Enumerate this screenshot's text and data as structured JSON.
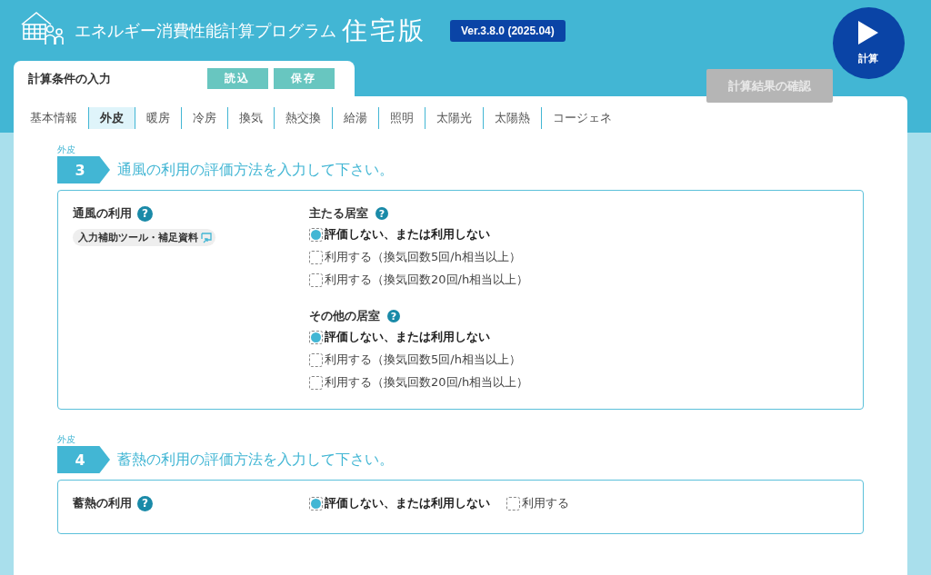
{
  "header": {
    "title": "エネルギー消費性能計算プログラム",
    "edition": "住宅版",
    "version": "Ver.3.8.0 (2025.04)",
    "run_button": "計算"
  },
  "input_panel": {
    "label": "計算条件の入力",
    "buttons": [
      "読込",
      "保存"
    ]
  },
  "result_tab": {
    "label": "計算結果の確認",
    "disabled": true
  },
  "tabs": [
    {
      "label": "基本情報",
      "selected": false
    },
    {
      "label": "外皮",
      "selected": true
    },
    {
      "label": "暖房",
      "selected": false
    },
    {
      "label": "冷房",
      "selected": false
    },
    {
      "label": "換気",
      "selected": false
    },
    {
      "label": "熱交換",
      "selected": false
    },
    {
      "label": "給湯",
      "selected": false
    },
    {
      "label": "照明",
      "selected": false
    },
    {
      "label": "太陽光",
      "selected": false
    },
    {
      "label": "太陽熱",
      "selected": false
    },
    {
      "label": "コージェネ",
      "selected": false
    }
  ],
  "sections": [
    {
      "category": "外皮",
      "number": "3",
      "title": "通風の利用の評価方法を入力して下さい。",
      "field_label": "通風の利用",
      "help": "?",
      "link": "入力補助ツール・補足資料",
      "kind": "grouped",
      "groups": [
        {
          "title": "主たる居室",
          "help": "?",
          "options": [
            {
              "label": "評価しない、または利用しない",
              "selected": true
            },
            {
              "label": "利用する（換気回数5回/h相当以上）",
              "selected": false
            },
            {
              "label": "利用する（換気回数20回/h相当以上）",
              "selected": false
            }
          ]
        },
        {
          "title": "その他の居室",
          "help": "?",
          "options": [
            {
              "label": "評価しない、または利用しない",
              "selected": true
            },
            {
              "label": "利用する（換気回数5回/h相当以上）",
              "selected": false
            },
            {
              "label": "利用する（換気回数20回/h相当以上）",
              "selected": false
            }
          ]
        }
      ]
    },
    {
      "category": "外皮",
      "number": "4",
      "title": "蓄熱の利用の評価方法を入力して下さい。",
      "field_label": "蓄熱の利用",
      "help": "?",
      "kind": "inline",
      "groups": [
        {
          "options": [
            {
              "label": "評価しない、または利用しない",
              "selected": true
            },
            {
              "label": "利用する",
              "selected": false
            }
          ]
        }
      ]
    }
  ]
}
